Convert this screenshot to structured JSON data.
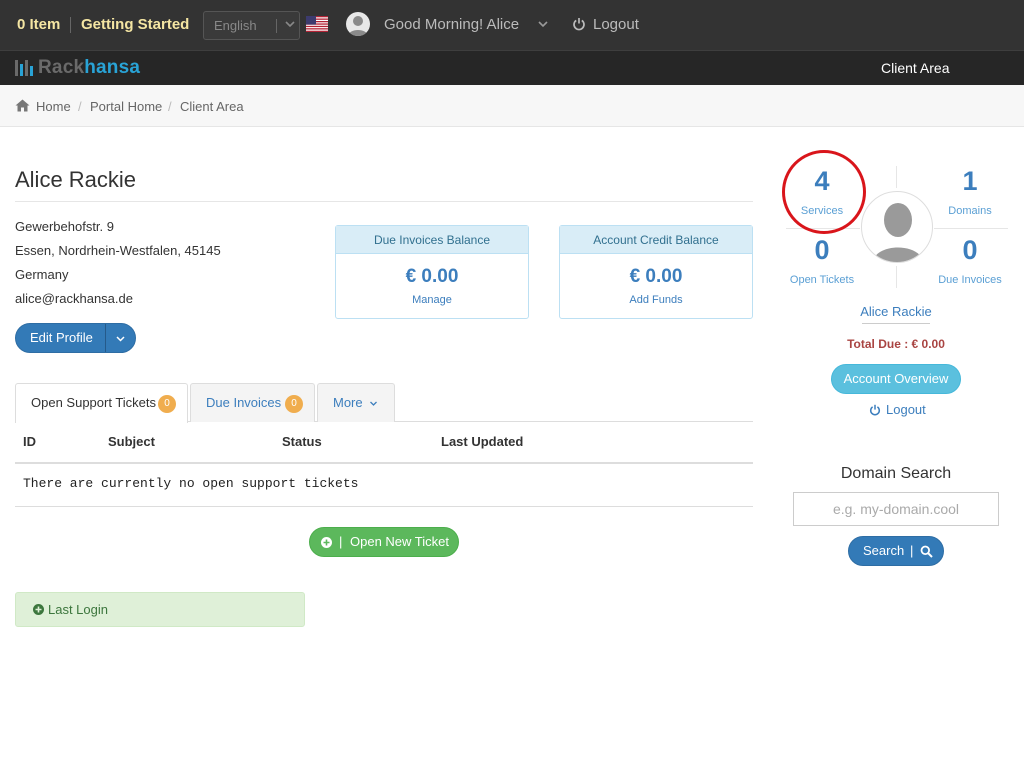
{
  "topbar": {
    "cart": "0 Item",
    "getting_started": "Getting Started",
    "language": "English",
    "greeting": "Good Morning! Alice",
    "logout": "Logout"
  },
  "brand": {
    "logo_part1": "Rack",
    "logo_part2": "hansa",
    "nav_client_area": "Client Area",
    "colors": {
      "logo_blue": "#29a3d6",
      "bar": "#262626"
    }
  },
  "breadcrumb": {
    "items": [
      "Home",
      "Portal Home",
      "Client Area"
    ],
    "separator": "/"
  },
  "profile": {
    "name": "Alice Rackie",
    "address": [
      "Gewerbehofstr. 9",
      "Essen, Nordrhein-Westfalen, 45145",
      "Germany",
      "alice@rackhansa.de"
    ],
    "edit_button": "Edit Profile"
  },
  "balances": [
    {
      "title": "Due Invoices Balance",
      "amount": "€ 0.00",
      "link": "Manage"
    },
    {
      "title": "Account Credit Balance",
      "amount": "€ 0.00",
      "link": "Add Funds"
    }
  ],
  "tabs": [
    {
      "label": "Open Support Tickets",
      "badge": "0"
    },
    {
      "label": "Due Invoices",
      "badge": "0"
    },
    {
      "label": "More"
    }
  ],
  "tickets_table": {
    "columns": [
      "ID",
      "Subject",
      "Status",
      "Last Updated"
    ],
    "empty_message": "There are currently no open support tickets",
    "open_ticket_button_separator": "|",
    "open_ticket_button": "Open New Ticket"
  },
  "last_login": {
    "label": "Last Login"
  },
  "sidebar": {
    "stats": [
      {
        "value": "4",
        "label": "Services"
      },
      {
        "value": "1",
        "label": "Domains"
      },
      {
        "value": "0",
        "label": "Open Tickets"
      },
      {
        "value": "0",
        "label": "Due Invoices"
      }
    ],
    "user_name": "Alice Rackie",
    "total_due": "Total Due : € 0.00",
    "account_overview_button": "Account Overview",
    "logout": "Logout"
  },
  "domain_search": {
    "title": "Domain Search",
    "placeholder": "e.g. my-domain.cool",
    "button": "Search",
    "button_separator": "|"
  }
}
